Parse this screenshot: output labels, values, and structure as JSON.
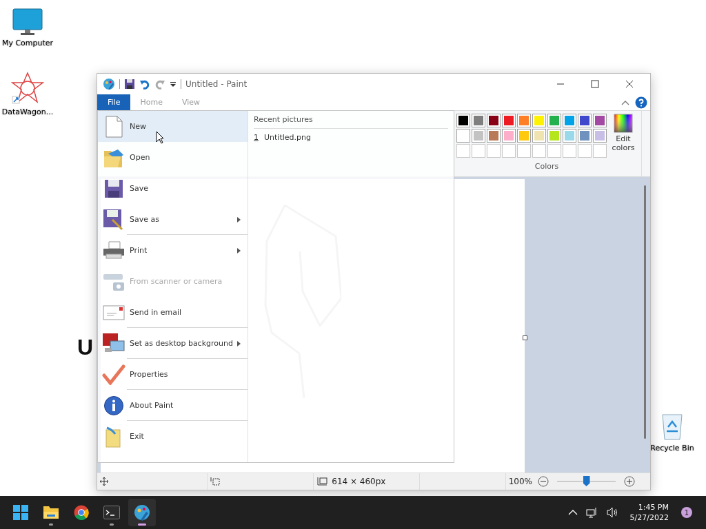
{
  "desktop_icons": [
    {
      "kind": "computer",
      "label": "My Computer"
    },
    {
      "kind": "star",
      "label": "DataWagon..."
    },
    {
      "kind": "recycle",
      "label": "Recycle Bin"
    }
  ],
  "desktop_text": "U",
  "window": {
    "title": "Untitled - Paint"
  },
  "tabs": [
    {
      "label": "File",
      "selected": true
    },
    {
      "label": "Home",
      "selected": false
    },
    {
      "label": "View",
      "selected": false
    }
  ],
  "file_menu": {
    "items": [
      {
        "kind": "new",
        "label": "New",
        "selected": true,
        "submenu": false,
        "disabled": false,
        "divider": false
      },
      {
        "kind": "open",
        "label": "Open",
        "selected": false,
        "submenu": false,
        "disabled": false,
        "divider": false
      },
      {
        "kind": "save",
        "label": "Save",
        "selected": false,
        "submenu": false,
        "disabled": false,
        "divider": false
      },
      {
        "kind": "saveas",
        "label": "Save as",
        "selected": false,
        "submenu": true,
        "disabled": false,
        "divider": true
      },
      {
        "kind": "print",
        "label": "Print",
        "selected": false,
        "submenu": true,
        "disabled": false,
        "divider": false
      },
      {
        "kind": "scanner",
        "label": "From scanner or camera",
        "selected": false,
        "submenu": false,
        "disabled": true,
        "divider": false
      },
      {
        "kind": "email",
        "label": "Send in email",
        "selected": false,
        "submenu": false,
        "disabled": false,
        "divider": true
      },
      {
        "kind": "desktop",
        "label": "Set as desktop background",
        "selected": false,
        "submenu": true,
        "disabled": false,
        "divider": true
      },
      {
        "kind": "properties",
        "label": "Properties",
        "selected": false,
        "submenu": false,
        "disabled": false,
        "divider": true
      },
      {
        "kind": "about",
        "label": "About Paint",
        "selected": false,
        "submenu": false,
        "disabled": false,
        "divider": true
      },
      {
        "kind": "exit",
        "label": "Exit",
        "selected": false,
        "submenu": false,
        "disabled": false,
        "divider": false
      }
    ],
    "recent": {
      "title": "Recent pictures",
      "items": [
        {
          "number": "1",
          "name": "Untitled.png"
        }
      ]
    }
  },
  "palette": {
    "rows": [
      [
        {
          "color": "#000000"
        },
        {
          "color": "#7f7f7f"
        },
        {
          "color": "#880015"
        },
        {
          "color": "#ed1c24"
        },
        {
          "color": "#ff7f27"
        },
        {
          "color": "#fff200"
        },
        {
          "color": "#22b14c"
        },
        {
          "color": "#00a2e8"
        },
        {
          "color": "#3f48cc"
        },
        {
          "color": "#a349a4"
        }
      ],
      [
        {
          "color": "#ffffff"
        },
        {
          "color": "#c3c3c3"
        },
        {
          "color": "#b97a57"
        },
        {
          "color": "#ffaec9"
        },
        {
          "color": "#ffc90e"
        },
        {
          "color": "#efe4b0"
        },
        {
          "color": "#b5e61d"
        },
        {
          "color": "#99d9ea"
        },
        {
          "color": "#7092be"
        },
        {
          "color": "#c8bfe7"
        }
      ]
    ],
    "edit_label": "Edit colors",
    "group_label": "Colors"
  },
  "status_bar": {
    "size": "614 × 460px",
    "zoom": "100%",
    "zoom_level": {
      "level": 0.5
    }
  },
  "taskbar": {
    "apps": [
      {
        "kind": "windows",
        "running": false,
        "active": false
      },
      {
        "kind": "folder",
        "running": true,
        "active": false
      },
      {
        "kind": "chrome",
        "running": false,
        "active": false
      },
      {
        "kind": "terminal",
        "running": true,
        "active": false
      },
      {
        "kind": "paint",
        "running": true,
        "active": true
      }
    ],
    "time": "1:45 PM",
    "date": "5/27/2022",
    "notifications": "1"
  }
}
